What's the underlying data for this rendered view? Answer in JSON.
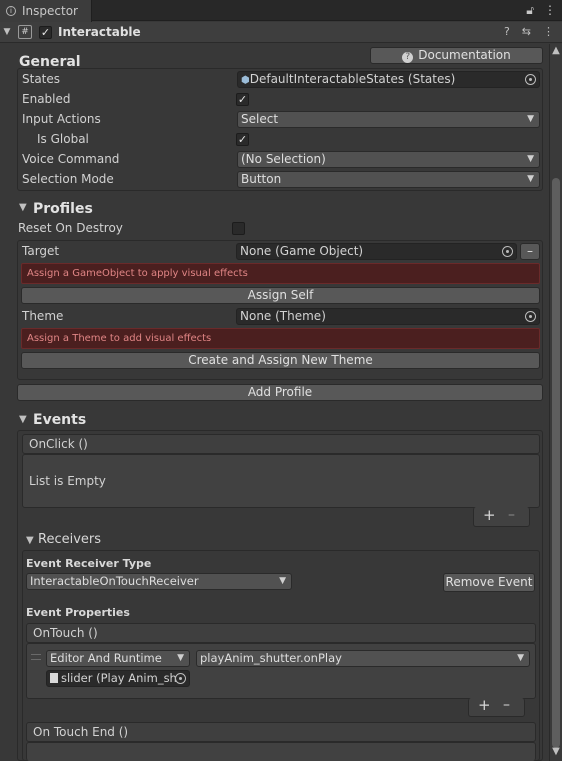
{
  "tab": {
    "label": "Inspector"
  },
  "component": {
    "title": "Interactable",
    "enabled_mark": "✓"
  },
  "toolbar": {
    "documentation_label": "Documentation"
  },
  "general": {
    "heading": "General",
    "states_label": "States",
    "states_value": "DefaultInteractableStates (States)",
    "enabled_label": "Enabled",
    "input_actions_label": "Input Actions",
    "input_actions_value": "Select",
    "is_global_label": "Is Global",
    "voice_command_label": "Voice Command",
    "voice_command_value": "(No Selection)",
    "selection_mode_label": "Selection Mode",
    "selection_mode_value": "Button",
    "check_mark": "✓"
  },
  "profiles": {
    "heading": "Profiles",
    "reset_on_destroy_label": "Reset On Destroy",
    "target_label": "Target",
    "target_value": "None (Game Object)",
    "target_error": "Assign a GameObject to apply visual effects",
    "assign_self_label": "Assign Self",
    "theme_label": "Theme",
    "theme_value": "None (Theme)",
    "theme_error": "Assign a Theme to add visual effects",
    "create_theme_label": "Create and Assign New Theme",
    "add_profile_label": "Add Profile",
    "remove_mark": "–"
  },
  "events": {
    "heading": "Events",
    "onclick_header": "OnClick ()",
    "list_empty": "List is Empty",
    "plus": "+",
    "minus": "–"
  },
  "receivers": {
    "heading": "Receivers",
    "event_receiver_type_label": "Event Receiver Type",
    "event_receiver_type_value": "InteractableOnTouchReceiver",
    "remove_event_label": "Remove Event",
    "event_properties_label": "Event Properties",
    "ontouch_header": "OnTouch ()",
    "runtime_value": "Editor And Runtime",
    "function_value": "playAnim_shutter.onPlay",
    "object_value": "slider (Play Anim_sh",
    "ontouch_end_header": "On Touch End ()"
  }
}
